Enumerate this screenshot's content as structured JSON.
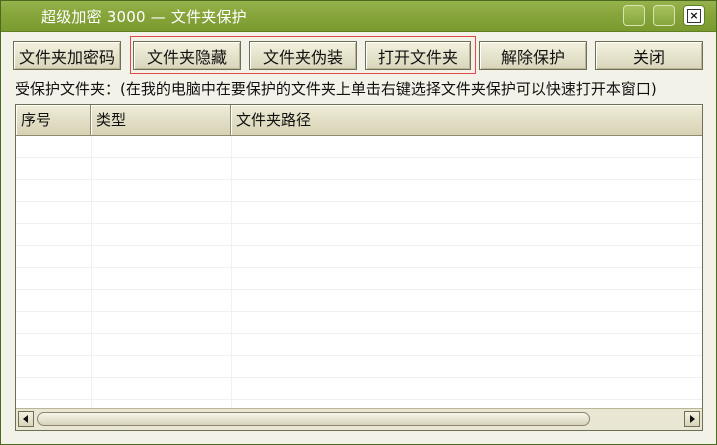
{
  "window": {
    "title": "超级加密 3000 — 文件夹保护"
  },
  "toolbar": {
    "buttons": [
      {
        "id": "folder-encrypt",
        "label": "文件夹加密码"
      },
      {
        "id": "folder-hide",
        "label": "文件夹隐藏"
      },
      {
        "id": "folder-disguise",
        "label": "文件夹伪装"
      },
      {
        "id": "open-folder",
        "label": "打开文件夹"
      },
      {
        "id": "remove-protection",
        "label": "解除保护"
      },
      {
        "id": "close",
        "label": "关闭"
      }
    ]
  },
  "info": {
    "label": "受保护文件夹：(在我的电脑中在要保护的文件夹上单击右键选择文件夹保护可以快速打开本窗口)"
  },
  "table": {
    "columns": [
      "序号",
      "类型",
      "文件夹路径"
    ],
    "rows": []
  },
  "colors": {
    "titlebar": "#86a43a",
    "highlight": "#e24a4a",
    "window_bg": "#f3f2e8"
  },
  "icons": {
    "close": "close-icon",
    "scroll_left": "arrow-left-icon",
    "scroll_right": "arrow-right-icon"
  }
}
